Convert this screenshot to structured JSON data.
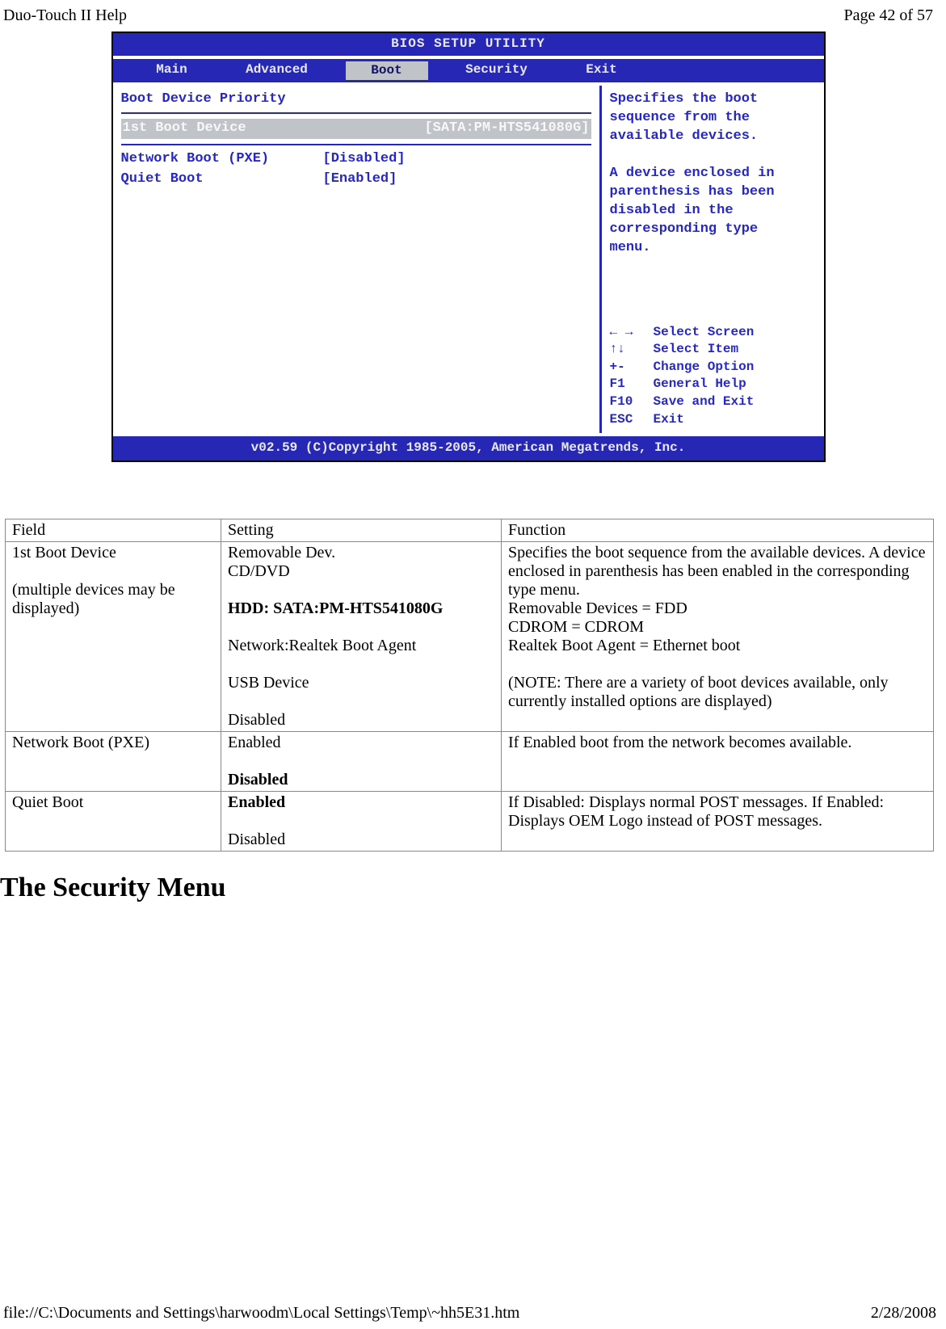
{
  "header": {
    "left": "Duo-Touch II Help",
    "right": "Page 42 of 57"
  },
  "footer": {
    "left": "file://C:\\Documents and Settings\\harwoodm\\Local Settings\\Temp\\~hh5E31.htm",
    "right": "2/28/2008"
  },
  "bios": {
    "title": "BIOS SETUP UTILITY",
    "tabs": [
      "Main",
      "Advanced",
      "Boot",
      "Security",
      "Exit"
    ],
    "active_tab": "Boot",
    "left": {
      "heading": "Boot Device Priority",
      "first_item_label": "1st Boot Device",
      "first_item_value": "[SATA:PM-HTS541080G]",
      "net_label": "Network Boot (PXE)",
      "net_value": "[Disabled]",
      "quiet_label": "Quiet Boot",
      "quiet_value": "[Enabled]"
    },
    "help": "Specifies the boot\nsequence from the\navailable devices.\n\nA device enclosed in\nparenthesis has been\ndisabled in the\ncorresponding type\nmenu.",
    "keys": [
      {
        "k": "← →",
        "d": "Select Screen"
      },
      {
        "k": "↑↓",
        "d": "Select Item"
      },
      {
        "k": "+-",
        "d": "Change Option"
      },
      {
        "k": "F1",
        "d": "General Help"
      },
      {
        "k": "F10",
        "d": "Save and Exit"
      },
      {
        "k": "ESC",
        "d": "Exit"
      }
    ],
    "footer": "v02.59 (C)Copyright 1985-2005, American Megatrends, Inc."
  },
  "table": {
    "h1": "Field",
    "h2": "Setting",
    "h3": "Function",
    "rows": [
      {
        "field_l1": "1st  Boot Device",
        "field_l2": "(multiple devices may be displayed)",
        "setting_l1": "Removable Dev.",
        "setting_l2": "CD/DVD",
        "setting_bold": "HDD: SATA:PM-HTS541080G",
        "setting_l4": "Network:Realtek Boot Agent",
        "setting_l5": "USB Device",
        "setting_l6": "Disabled",
        "func_l1": "Specifies the boot sequence from the available devices. A device enclosed in parenthesis has been enabled in the corresponding type menu.",
        "func_l2": "Removable Devices = FDD",
        "func_l3": "CDROM = CDROM",
        "func_l4": "Realtek Boot Agent = Ethernet boot",
        "func_l5": "(NOTE:  There are a variety of boot devices available, only currently installed options are displayed)"
      },
      {
        "field": "Network Boot (PXE)",
        "setting_l1": "Enabled",
        "setting_bold": "Disabled",
        "func": "If Enabled boot from the network becomes available."
      },
      {
        "field": "Quiet Boot",
        "setting_bold": "Enabled",
        "setting_l2": "Disabled",
        "func": "If Disabled: Displays normal POST messages.  If Enabled: Displays OEM Logo instead of POST messages."
      }
    ]
  },
  "section_title": "The Security Menu"
}
